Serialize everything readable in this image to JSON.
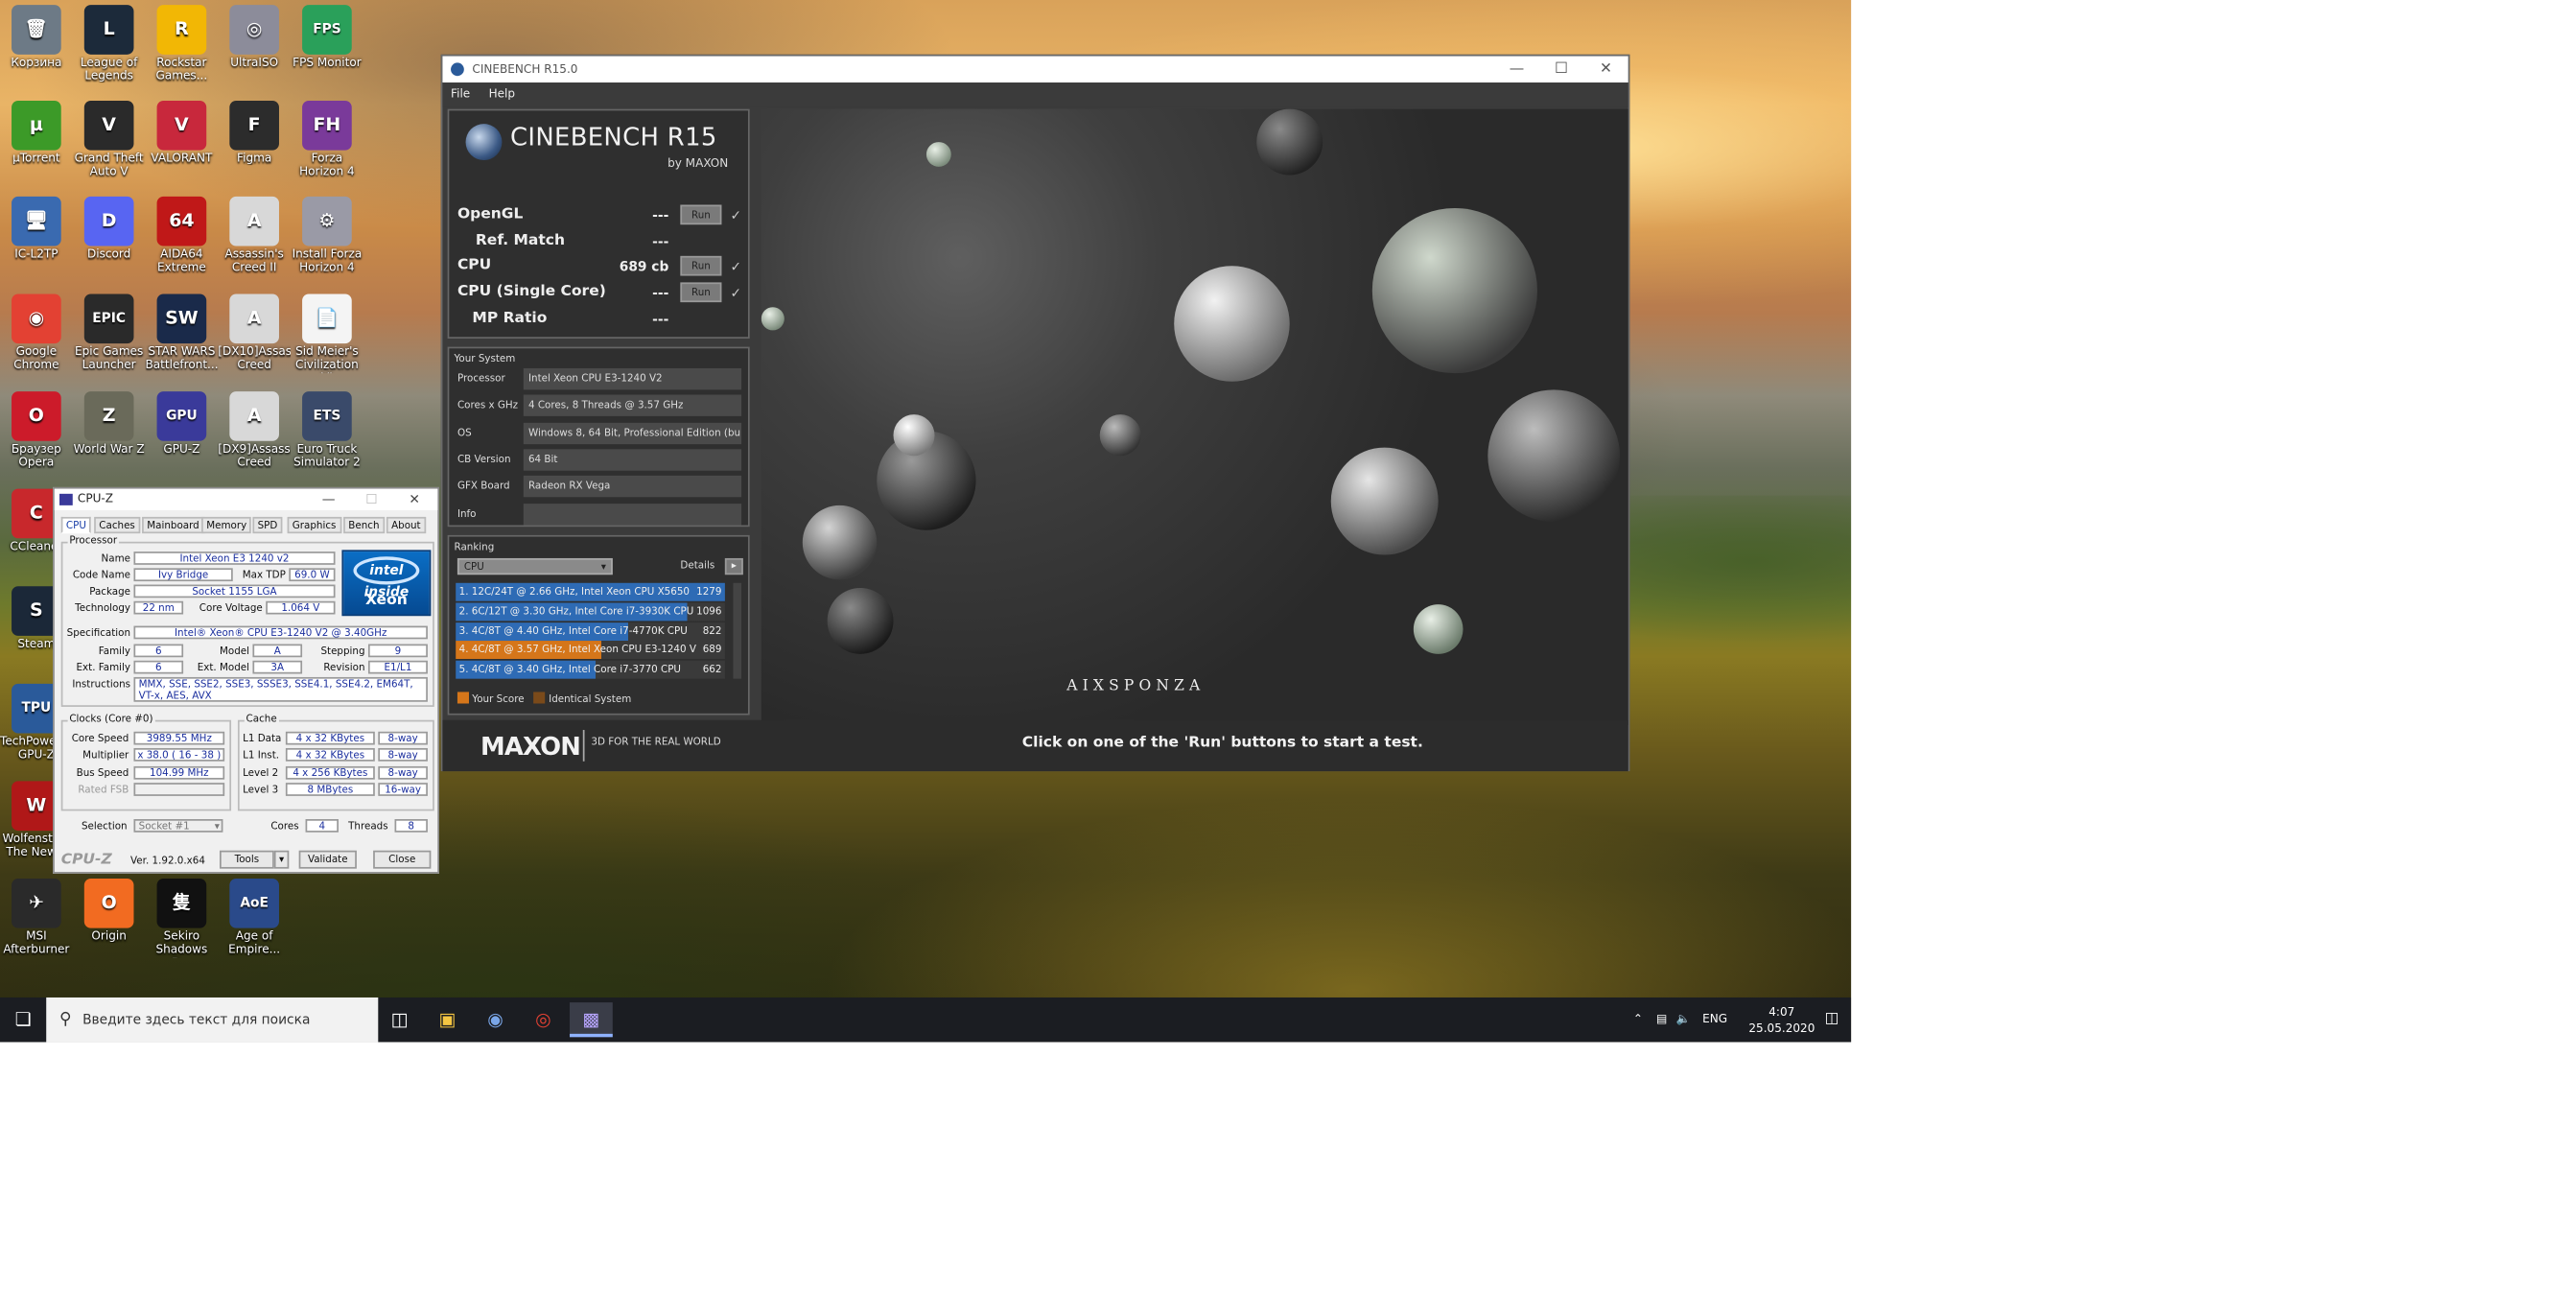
{
  "desktop": {
    "icons": [
      {
        "label": "Корзина",
        "name": "recycle-bin-icon",
        "glyph": "🗑",
        "bg": "#6d7a86"
      },
      {
        "label": "League of Legends",
        "name": "league-of-legends-icon",
        "glyph": "L",
        "bg": "#1c2a3a"
      },
      {
        "label": "Rockstar Games...",
        "name": "rockstar-games-icon",
        "glyph": "R",
        "bg": "#f2b705"
      },
      {
        "label": "UltraISO",
        "name": "ultraiso-icon",
        "glyph": "◎",
        "bg": "#8c8c9a"
      },
      {
        "label": "FPS Monitor",
        "name": "fps-monitor-icon",
        "glyph": "FPS",
        "bg": "#2aa05a"
      },
      {
        "label": "µTorrent",
        "name": "utorrent-icon",
        "glyph": "µ",
        "bg": "#3c9a28"
      },
      {
        "label": "Grand Theft Auto V",
        "name": "gta-v-icon",
        "glyph": "V",
        "bg": "#2a2a2a"
      },
      {
        "label": "VALORANT",
        "name": "valorant-icon",
        "glyph": "V",
        "bg": "#c8283c"
      },
      {
        "label": "Figma",
        "name": "figma-icon",
        "glyph": "F",
        "bg": "#2c2c2c"
      },
      {
        "label": "Forza Horizon 4",
        "name": "forza-horizon-4-icon",
        "glyph": "FH",
        "bg": "#7a3a9a"
      },
      {
        "label": "IC-L2TP",
        "name": "ic-l2tp-icon",
        "glyph": "🖥",
        "bg": "#3a6ab0"
      },
      {
        "label": "Discord",
        "name": "discord-icon",
        "glyph": "D",
        "bg": "#5865f2"
      },
      {
        "label": "AIDA64 Extreme",
        "name": "aida64-icon",
        "glyph": "64",
        "bg": "#c01818"
      },
      {
        "label": "Assassin's Creed II",
        "name": "assassins-creed-ii-icon",
        "glyph": "A",
        "bg": "#d8d8d8"
      },
      {
        "label": "Install Forza Horizon 4",
        "name": "install-forza-icon",
        "glyph": "⚙",
        "bg": "#9a9aa6"
      },
      {
        "label": "Google Chrome",
        "name": "google-chrome-icon",
        "glyph": "◉",
        "bg": "#e34133"
      },
      {
        "label": "Epic Games Launcher",
        "name": "epic-games-icon",
        "glyph": "EPIC",
        "bg": "#2a2a2a"
      },
      {
        "label": "STAR WARS Battlefront...",
        "name": "star-wars-battlefront-icon",
        "glyph": "SW",
        "bg": "#1a2a4a"
      },
      {
        "label": "[DX10]Assass... Creed",
        "name": "assassins-creed-dx10-icon",
        "glyph": "A",
        "bg": "#d8d8d8"
      },
      {
        "label": "Sid Meier's Civilization VI",
        "name": "civilization-vi-icon",
        "glyph": "📄",
        "bg": "#f4f4f4"
      },
      {
        "label": "Браузер Opera",
        "name": "opera-icon",
        "glyph": "O",
        "bg": "#cc1b2a"
      },
      {
        "label": "World War Z",
        "name": "world-war-z-icon",
        "glyph": "Z",
        "bg": "#6a6a5a"
      },
      {
        "label": "GPU-Z",
        "name": "gpu-z-desktop-icon",
        "glyph": "GPU",
        "bg": "#3a3a9a"
      },
      {
        "label": "[DX9]Assass... Creed",
        "name": "assassins-creed-dx9-icon",
        "glyph": "A",
        "bg": "#d8d8d8"
      },
      {
        "label": "Euro Truck Simulator 2",
        "name": "euro-truck-simulator-icon",
        "glyph": "ETS",
        "bg": "#3a4a6a"
      },
      {
        "label": "CCleaner",
        "name": "ccleaner-icon",
        "glyph": "C",
        "bg": "#c8282c"
      },
      {
        "label": "Steam",
        "name": "steam-icon",
        "glyph": "S",
        "bg": "#1b2838"
      },
      {
        "label": "TechPowerUp GPU-Z",
        "name": "techpowerup-gpu-z-icon",
        "glyph": "TPU",
        "bg": "#2a5a9a"
      },
      {
        "label": "Wolfenstein The New...",
        "name": "wolfenstein-icon",
        "glyph": "W",
        "bg": "#b01818"
      },
      {
        "label": "MSI Afterburner",
        "name": "msi-afterburner-icon",
        "glyph": "✈",
        "bg": "#2a2a2a"
      },
      {
        "label": "Origin",
        "name": "origin-icon",
        "glyph": "O",
        "bg": "#f26b21"
      },
      {
        "label": "Sekiro Shadows D...",
        "name": "sekiro-icon",
        "glyph": "隻",
        "bg": "#111111"
      },
      {
        "label": "Age of Empire...",
        "name": "age-of-empires-icon",
        "glyph": "AoE",
        "bg": "#2a4a8a"
      }
    ]
  },
  "taskbar": {
    "search_placeholder": "Введите здесь текст для поиска",
    "language": "ENG",
    "time": "4:07",
    "date": "25.05.2020"
  },
  "cinebench": {
    "title": "CINEBENCH R15.0",
    "menu": [
      "File",
      "Help"
    ],
    "logo_title": "CINEBENCH R15",
    "logo_sub": "by MAXON",
    "tests": {
      "opengl": {
        "label": "OpenGL",
        "value": "---",
        "run": "Run"
      },
      "ref_match": {
        "label": "Ref. Match",
        "value": "---"
      },
      "cpu": {
        "label": "CPU",
        "value": "689 cb",
        "run": "Run"
      },
      "cpu_single": {
        "label": "CPU (Single Core)",
        "value": "---",
        "run": "Run"
      },
      "mp_ratio": {
        "label": "MP Ratio",
        "value": "---"
      }
    },
    "your_system": {
      "heading": "Your System",
      "rows": [
        {
          "key": "Processor",
          "value": "Intel Xeon CPU E3-1240 V2"
        },
        {
          "key": "Cores x GHz",
          "value": "4 Cores, 8 Threads @ 3.57 GHz"
        },
        {
          "key": "OS",
          "value": "Windows 8, 64 Bit, Professional Edition (bu"
        },
        {
          "key": "CB Version",
          "value": "64 Bit"
        },
        {
          "key": "GFX Board",
          "value": "Radeon RX Vega"
        },
        {
          "key": "Info",
          "value": ""
        }
      ]
    },
    "ranking": {
      "heading": "Ranking",
      "dropdown": "CPU",
      "details": "Details",
      "rows": [
        {
          "text": "1. 12C/24T @ 2.66 GHz, Intel Xeon CPU X5650",
          "score": "1279",
          "fill": 1.0,
          "mine": false
        },
        {
          "text": "2. 6C/12T @ 3.30 GHz, Intel Core i7-3930K CPU",
          "score": "1096",
          "fill": 0.857,
          "mine": false
        },
        {
          "text": "3. 4C/8T @ 4.40 GHz, Intel Core i7-4770K CPU",
          "score": "822",
          "fill": 0.643,
          "mine": false
        },
        {
          "text": "4. 4C/8T @ 3.57 GHz, Intel Xeon CPU E3-1240 V",
          "score": "689",
          "fill": 0.539,
          "mine": true
        },
        {
          "text": "5. 4C/8T @ 3.40 GHz, Intel Core i7-3770 CPU",
          "score": "662",
          "fill": 0.518,
          "mine": false
        }
      ],
      "legend_your_score": "Your Score",
      "legend_identical": "Identical System"
    },
    "render_watermark": "AIXSPONZA",
    "footer": {
      "brand": "MAXON",
      "tagline": "3D FOR THE REAL WORLD",
      "message": "Click on one of the 'Run' buttons to start a test."
    }
  },
  "cpuz": {
    "title": "CPU-Z",
    "tabs": [
      "CPU",
      "Caches",
      "Mainboard",
      "Memory",
      "SPD",
      "Graphics",
      "Bench",
      "About"
    ],
    "processor_heading": "Processor",
    "name": {
      "label": "Name",
      "value": "Intel Xeon E3 1240 v2"
    },
    "code_name": {
      "label": "Code Name",
      "value": "Ivy Bridge"
    },
    "max_tdp": {
      "label": "Max TDP",
      "value": "69.0 W"
    },
    "package": {
      "label": "Package",
      "value": "Socket 1155 LGA"
    },
    "technology": {
      "label": "Technology",
      "value": "22 nm"
    },
    "core_voltage": {
      "label": "Core Voltage",
      "value": "1.064 V"
    },
    "specification": {
      "label": "Specification",
      "value": "Intel® Xeon® CPU E3-1240 V2 @ 3.40GHz"
    },
    "family": {
      "label": "Family",
      "value": "6"
    },
    "model": {
      "label": "Model",
      "value": "A"
    },
    "stepping": {
      "label": "Stepping",
      "value": "9"
    },
    "ext_family": {
      "label": "Ext. Family",
      "value": "6"
    },
    "ext_model": {
      "label": "Ext. Model",
      "value": "3A"
    },
    "revision": {
      "label": "Revision",
      "value": "E1/L1"
    },
    "instructions": {
      "label": "Instructions",
      "value": "MMX, SSE, SSE2, SSE3, SSSE3, SSE4.1, SSE4.2, EM64T, VT-x, AES, AVX"
    },
    "intel_badge": {
      "inside": "intel inside",
      "brand": "Xeon"
    },
    "clocks_heading": "Clocks (Core #0)",
    "core_speed": {
      "label": "Core Speed",
      "value": "3989.55 MHz"
    },
    "multiplier": {
      "label": "Multiplier",
      "value": "x 38.0 ( 16 - 38 )"
    },
    "bus_speed": {
      "label": "Bus Speed",
      "value": "104.99 MHz"
    },
    "rated_fsb": {
      "label": "Rated FSB",
      "value": ""
    },
    "cache_heading": "Cache",
    "l1_data": {
      "label": "L1 Data",
      "value": "4 x 32 KBytes",
      "way": "8-way"
    },
    "l1_inst": {
      "label": "L1 Inst.",
      "value": "4 x 32 KBytes",
      "way": "8-way"
    },
    "level2": {
      "label": "Level 2",
      "value": "4 x 256 KBytes",
      "way": "8-way"
    },
    "level3": {
      "label": "Level 3",
      "value": "8 MBytes",
      "way": "16-way"
    },
    "selection": {
      "label": "Selection",
      "value": "Socket #1"
    },
    "cores": {
      "label": "Cores",
      "value": "4"
    },
    "threads": {
      "label": "Threads",
      "value": "8"
    },
    "brand": "CPU-Z",
    "version": "Ver. 1.92.0.x64",
    "tools": "Tools",
    "validate": "Validate",
    "close": "Close"
  },
  "colors": {
    "cb_panel": "#3b3b3b",
    "rank_blue": "#2e6bb5",
    "rank_orange": "#d5761a",
    "cpuz_value": "#1b2f9e"
  }
}
